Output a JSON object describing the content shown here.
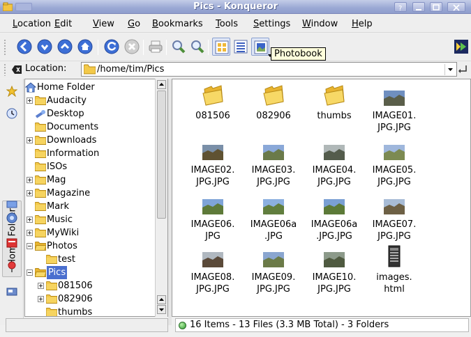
{
  "window": {
    "title": "Pics - Konqueror"
  },
  "menu": [
    "Location",
    "Edit",
    "View",
    "Go",
    "Bookmarks",
    "Tools",
    "Settings",
    "Window",
    "Help"
  ],
  "toolbar": {
    "tooltip": "Photobook",
    "buttons": [
      "back",
      "forward",
      "up",
      "home",
      "reload",
      "stop",
      "print",
      "zoom-in",
      "zoom-out",
      "icon-view",
      "detail-view",
      "photobook-view"
    ]
  },
  "location": {
    "label": "Location:",
    "value": "/home/tim/Pics"
  },
  "sidebar": {
    "tab_label": "Home Folder"
  },
  "tree": [
    {
      "label": "Home Folder",
      "depth": 0,
      "expander": "none",
      "icon": "home"
    },
    {
      "label": "Audacity",
      "depth": 1,
      "expander": "plus",
      "icon": "folder"
    },
    {
      "label": "Desktop",
      "depth": 1,
      "expander": "none",
      "icon": "desktop"
    },
    {
      "label": "Documents",
      "depth": 1,
      "expander": "none",
      "icon": "folder"
    },
    {
      "label": "Downloads",
      "depth": 1,
      "expander": "plus",
      "icon": "folder"
    },
    {
      "label": "Information",
      "depth": 1,
      "expander": "none",
      "icon": "folder"
    },
    {
      "label": "ISOs",
      "depth": 1,
      "expander": "none",
      "icon": "folder"
    },
    {
      "label": "Mag",
      "depth": 1,
      "expander": "plus",
      "icon": "folder"
    },
    {
      "label": "Magazine",
      "depth": 1,
      "expander": "plus",
      "icon": "folder"
    },
    {
      "label": "Mark",
      "depth": 1,
      "expander": "none",
      "icon": "folder"
    },
    {
      "label": "Music",
      "depth": 1,
      "expander": "plus",
      "icon": "folder"
    },
    {
      "label": "MyWiki",
      "depth": 1,
      "expander": "plus",
      "icon": "folder"
    },
    {
      "label": "Photos",
      "depth": 1,
      "expander": "minus",
      "icon": "folder-open"
    },
    {
      "label": "test",
      "depth": 2,
      "expander": "none",
      "icon": "folder"
    },
    {
      "label": "Pics",
      "depth": 1,
      "expander": "minus",
      "icon": "folder-open",
      "selected": true
    },
    {
      "label": "081506",
      "depth": 2,
      "expander": "plus",
      "icon": "folder"
    },
    {
      "label": "082906",
      "depth": 2,
      "expander": "plus",
      "icon": "folder"
    },
    {
      "label": "thumbs",
      "depth": 2,
      "expander": "none",
      "icon": "folder"
    }
  ],
  "files": [
    {
      "name": "081506",
      "kind": "folder"
    },
    {
      "name": "082906",
      "kind": "folder"
    },
    {
      "name": "thumbs",
      "kind": "folder"
    },
    {
      "name": "IMAGE01.\nJPG.JPG",
      "kind": "image",
      "sky": "#6f8fc0",
      "ground": "#5a5e4a"
    },
    {
      "name": "IMAGE02.\nJPG.JPG",
      "kind": "image",
      "sky": "#7a8fa8",
      "ground": "#5f5232"
    },
    {
      "name": "IMAGE03.\nJPG.JPG",
      "kind": "image",
      "sky": "#8aa8d8",
      "ground": "#6a7a4a"
    },
    {
      "name": "IMAGE04.\nJPG.JPG",
      "kind": "image",
      "sky": "#b0b8b8",
      "ground": "#545c4c"
    },
    {
      "name": "IMAGE05.\nJPG.JPG",
      "kind": "image",
      "sky": "#9fb7dc",
      "ground": "#7c8a52"
    },
    {
      "name": "IMAGE06.\nJPG",
      "kind": "image",
      "sky": "#7fa4d8",
      "ground": "#5e7a3a"
    },
    {
      "name": "IMAGE06a\n.JPG",
      "kind": "image",
      "sky": "#8cb0e0",
      "ground": "#627e3e"
    },
    {
      "name": "IMAGE06a\n.JPG.JPG",
      "kind": "image",
      "sky": "#7aa0d4",
      "ground": "#5c7a38"
    },
    {
      "name": "IMAGE07.\nJPG.JPG",
      "kind": "image",
      "sky": "#a8bcd6",
      "ground": "#6d6045"
    },
    {
      "name": "IMAGE08.\nJPG.JPG",
      "kind": "image",
      "sky": "#b0b8c0",
      "ground": "#5b4a3a"
    },
    {
      "name": "IMAGE09.\nJPG.JPG",
      "kind": "image",
      "sky": "#8aa6d0",
      "ground": "#6b7b48"
    },
    {
      "name": "IMAGE10.\nJPG.JPG",
      "kind": "image",
      "sky": "#8c9a8a",
      "ground": "#4f5a40"
    },
    {
      "name": "images.\nhtml",
      "kind": "html"
    }
  ],
  "status": {
    "text": "16 Items - 13 Files (3.3 MB Total) - 3 Folders"
  },
  "colors": {
    "selection": "#4a6fcf",
    "folder": "#f3c94a",
    "titlebar": "#9aa8d4"
  }
}
